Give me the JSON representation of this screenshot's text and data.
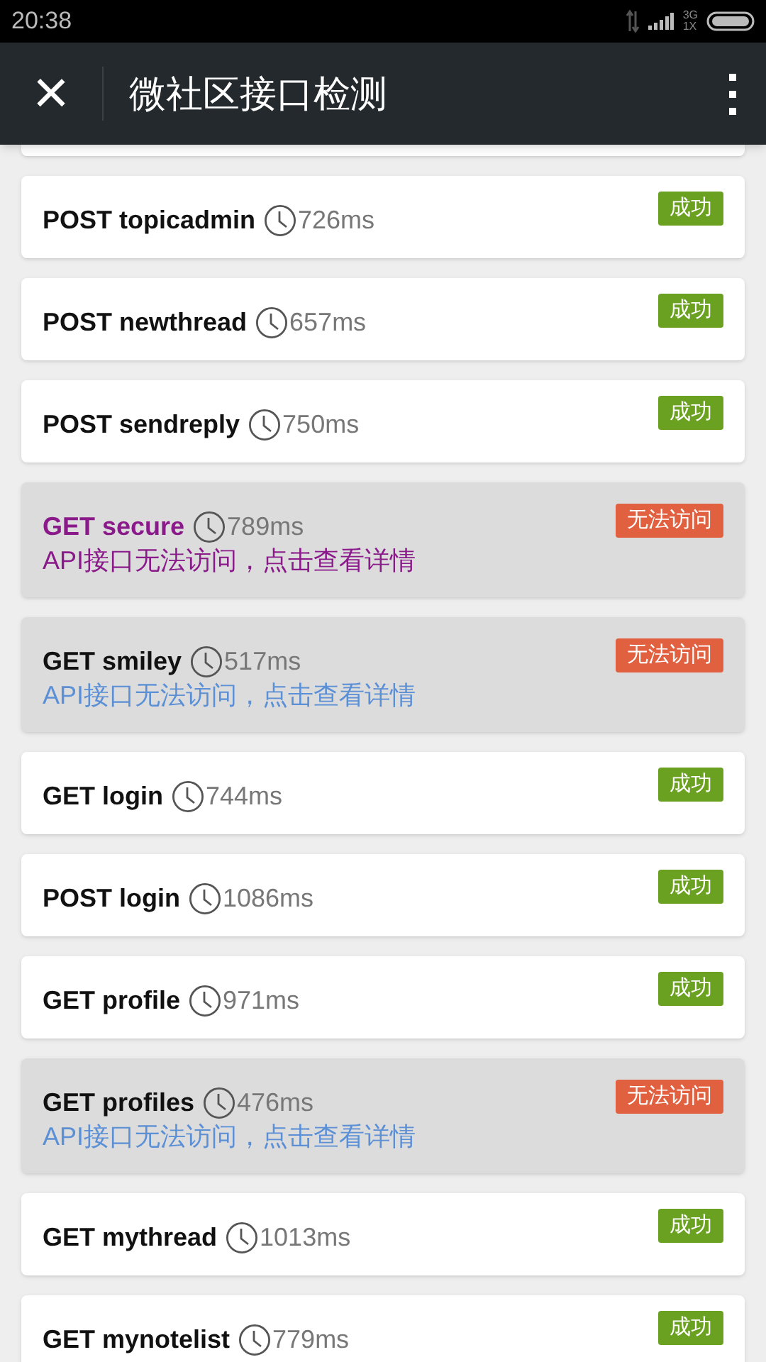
{
  "status_bar": {
    "time": "20:38",
    "network_top": "3G",
    "network_bottom": "1X"
  },
  "app_bar": {
    "close": "×",
    "title": "微社区接口检测"
  },
  "items": [
    {
      "kind": "partial"
    },
    {
      "kind": "success",
      "name": "POST topicadmin",
      "time": "726ms",
      "status": "成功",
      "visited": false
    },
    {
      "kind": "success",
      "name": "POST newthread",
      "time": "657ms",
      "status": "成功",
      "visited": false
    },
    {
      "kind": "success",
      "name": "POST sendreply",
      "time": "750ms",
      "status": "成功",
      "visited": false
    },
    {
      "kind": "failure",
      "name": "GET secure",
      "time": "789ms",
      "status": "无法访问",
      "message": "API接口无法访问，点击查看详情",
      "visited": true
    },
    {
      "kind": "failure",
      "name": "GET smiley",
      "time": "517ms",
      "status": "无法访问",
      "message": "API接口无法访问，点击查看详情",
      "visited": false
    },
    {
      "kind": "success",
      "name": "GET login",
      "time": "744ms",
      "status": "成功",
      "visited": false
    },
    {
      "kind": "success",
      "name": "POST login",
      "time": "1086ms",
      "status": "成功",
      "visited": false
    },
    {
      "kind": "success",
      "name": "GET profile",
      "time": "971ms",
      "status": "成功",
      "visited": false
    },
    {
      "kind": "failure",
      "name": "GET profiles",
      "time": "476ms",
      "status": "无法访问",
      "message": "API接口无法访问，点击查看详情",
      "visited": false
    },
    {
      "kind": "success",
      "name": "GET mythread",
      "time": "1013ms",
      "status": "成功",
      "visited": false
    },
    {
      "kind": "success",
      "name": "GET mynotelist",
      "time": "779ms",
      "status": "成功",
      "visited": false
    }
  ]
}
